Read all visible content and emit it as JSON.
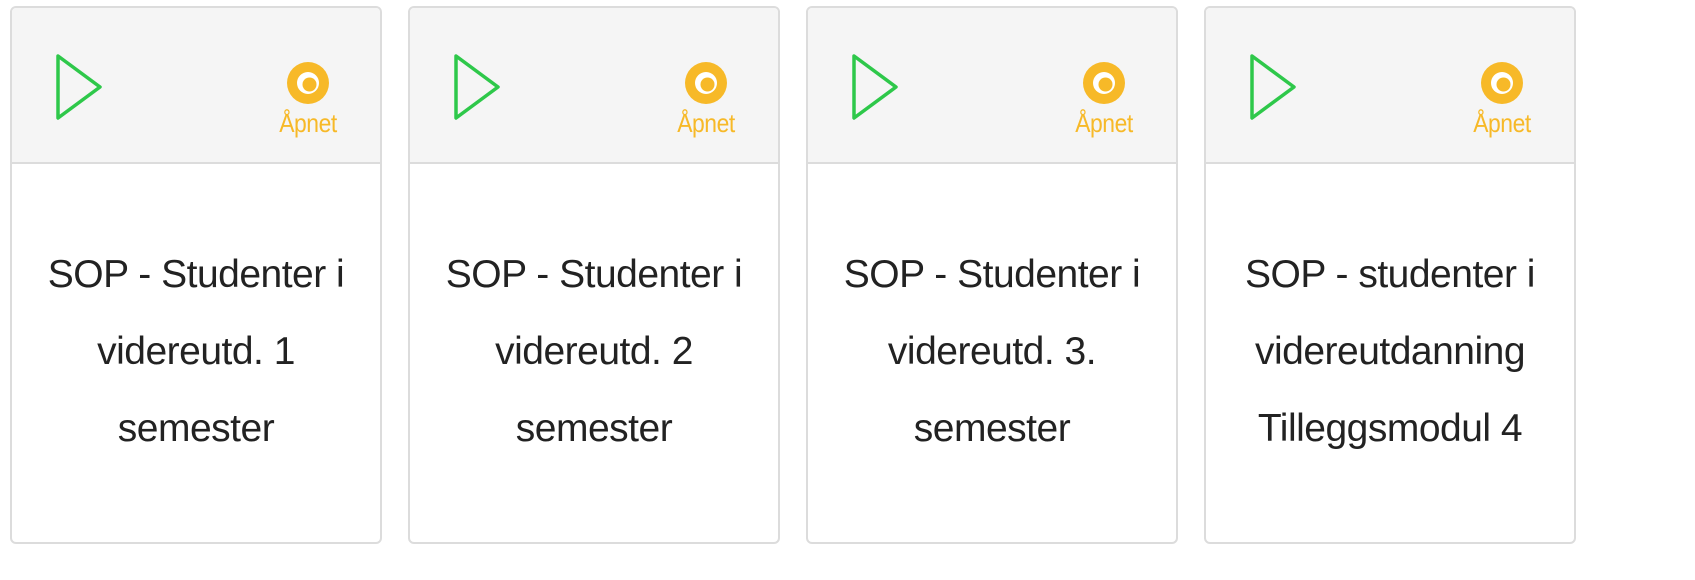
{
  "cards": [
    {
      "play_icon": "play-icon",
      "status": {
        "icon": "eye-icon",
        "label": "Åpnet"
      },
      "title": "SOP - Studenter i videreutd. 1 semester"
    },
    {
      "play_icon": "play-icon",
      "status": {
        "icon": "eye-icon",
        "label": "Åpnet"
      },
      "title": "SOP - Studenter i videreutd. 2 semester"
    },
    {
      "play_icon": "play-icon",
      "status": {
        "icon": "eye-icon",
        "label": "Åpnet"
      },
      "title": "SOP - Studenter i videreutd. 3. semester"
    },
    {
      "play_icon": "play-icon",
      "status": {
        "icon": "eye-icon",
        "label": "Åpnet"
      },
      "title": "SOP - studenter i videreutdanning Tilleggsmodul 4"
    }
  ],
  "colors": {
    "play": "#2ec84a",
    "status": "#f7b928",
    "card_border": "#dcdcdc",
    "header_bg": "#f5f5f5",
    "title_text": "#222222"
  }
}
